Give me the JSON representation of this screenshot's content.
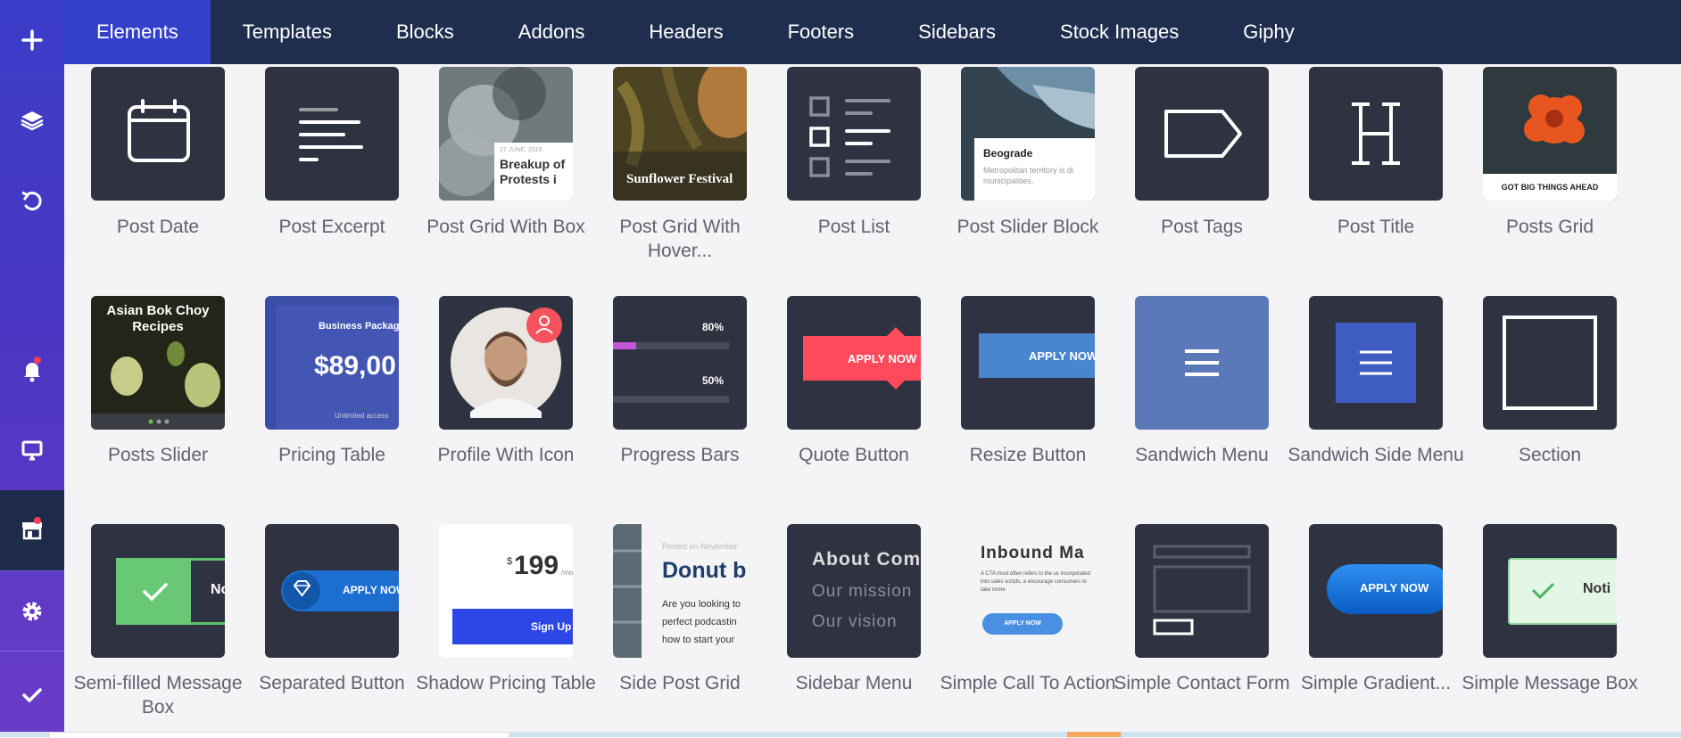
{
  "sidebar": {
    "icons": [
      "plus-icon",
      "layers-icon",
      "undo-icon",
      "bell-icon",
      "monitor-icon",
      "store-icon",
      "gear-icon",
      "check-icon"
    ]
  },
  "tabs": [
    "Elements",
    "Templates",
    "Blocks",
    "Addons",
    "Headers",
    "Footers",
    "Sidebars",
    "Stock Images",
    "Giphy"
  ],
  "elements": {
    "row1": [
      "Post Date",
      "Post Excerpt",
      "Post Grid With Box",
      "Post Grid With Hover...",
      "Post List",
      "Post Slider Block",
      "Post Tags",
      "Post Title",
      "Posts Grid"
    ],
    "row2": [
      "Posts Slider",
      "Pricing Table",
      "Profile With Icon",
      "Progress Bars",
      "Quote Button",
      "Resize Button",
      "Sandwich Menu",
      "Sandwich Side Menu",
      "Section"
    ],
    "row3": [
      "Semi-filled Message Box",
      "Separated Button",
      "Shadow Pricing Table",
      "Side Post Grid",
      "Sidebar Menu",
      "Simple Call To Action",
      "Simple Contact Form",
      "Simple Gradient...",
      "Simple Message Box"
    ]
  },
  "thumbs": {
    "grid_with_box_date": "27 JUNE, 2019",
    "grid_with_box_title": "Breakup of Protests i",
    "sunflower": "Sunflower Festival",
    "beograde_title": "Beograde",
    "beograde_text": "Metropolitan territory is di municipalities.",
    "posts_grid_caption": "GOT BIG THINGS AHEAD",
    "asian": "Asian Bok Choy Recipes",
    "pricing_pkg": "Business Package",
    "pricing_price": "$89,00",
    "pricing_unlimited": "Unlimited access",
    "progress_80": "80%",
    "progress_50": "50%",
    "progress_80_level": 0.8,
    "progress_50_level": 0.5,
    "apply_now": "APPLY NOW",
    "shadow_price": "199",
    "shadow_currency": "$",
    "shadow_per": "/mo",
    "shadow_signup": "Sign Up",
    "side_posted": "Posted on November",
    "side_title": "Donut b",
    "side_text": "Are you looking to perfect podcastin how to start your",
    "about": "About Com",
    "mission": "Our mission",
    "vision": "Our vision",
    "inbound": "Inbound Ma",
    "inbound_text": "A CTA most often refers to the us incorporated into sales scripts, a encourage consumers to take imme",
    "inbound_btn": "APPLY NOW",
    "notif": "Noti",
    "semi_text": "No"
  },
  "colors": {
    "sidebar_top": "#3a3dc9",
    "topbar": "#1f2d4e",
    "active_tab": "#3340c9",
    "tile_dark": "#2f3240",
    "quote_red": "#ff4a5c",
    "resize_blue": "#4a86d0",
    "sandwich_blue": "#5b78b8",
    "sandwich_side_blue": "#3f5cc2"
  }
}
